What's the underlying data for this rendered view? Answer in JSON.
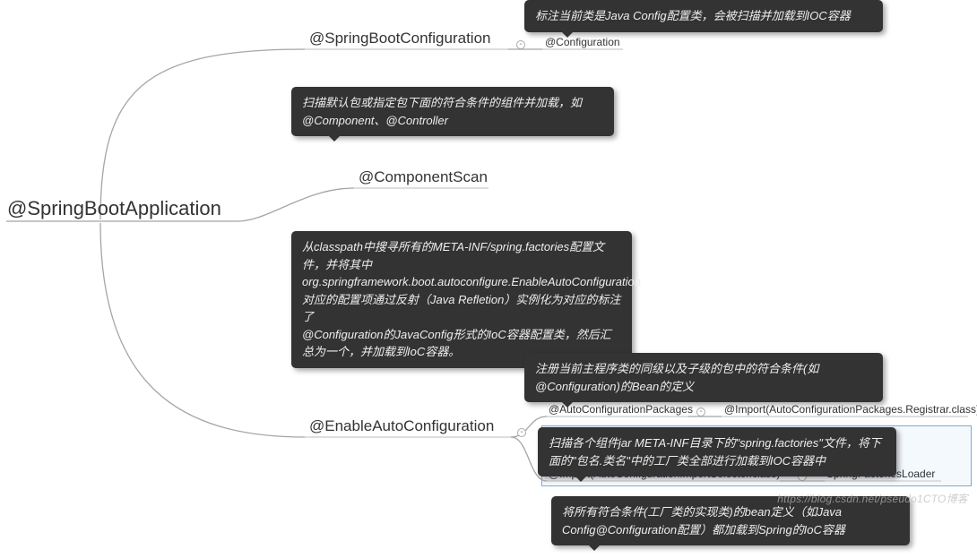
{
  "root": {
    "label": "@SpringBootApplication"
  },
  "nodes": {
    "springBootConfiguration": {
      "label": "@SpringBootConfiguration",
      "tooltip": "标注当前类是Java Config配置类，会被扫描并加载到IOC容器",
      "child": {
        "label": "@Configuration"
      }
    },
    "componentScan": {
      "label": "@ComponentScan",
      "tooltip": "扫描默认包或指定包下面的符合条件的组件并加载，如 @Component、@Controller"
    },
    "enableAutoConfiguration": {
      "label": "@EnableAutoConfiguration",
      "tooltip_lines": [
        "从classpath中搜寻所有的META-INF/spring.factories配置文件，并将其中",
        "org.springframework.boot.autoconfigure.EnableAutoConfiguration",
        "对应的配置项通过反射（Java Refletion）实例化为对应的标注了",
        "@Configuration的JavaConfig形式的IoC容器配置类，然后汇总为一个，并加载到IoC容器。"
      ],
      "children": {
        "autoConfigurationPackages": {
          "label": "@AutoConfigurationPackages",
          "tooltip": "注册当前主程序类的同级以及子级的包中的符合条件(如@Configuration)的Bean的定义",
          "child": {
            "label": "@Import(AutoConfigurationPackages.Registrar.class)"
          }
        },
        "importSelector": {
          "label": "@Import(AutoConfigurationImportSelector.class)",
          "tooltip": "扫描各个组件jar META-INF目录下的\"spring.factories\"文件，将下面的\"包名.类名\"中的工厂类全部进行加载到IOC容器中",
          "child": {
            "label": "SpringFactoriesLoader",
            "tooltip": "将所有符合条件(工厂类的实现类)的bean定义（如Java Config@Configuration配置）都加载到Spring的IoC容器"
          }
        }
      }
    }
  },
  "watermark": "https://blog.csdn.net/pseudo1CTO博客"
}
